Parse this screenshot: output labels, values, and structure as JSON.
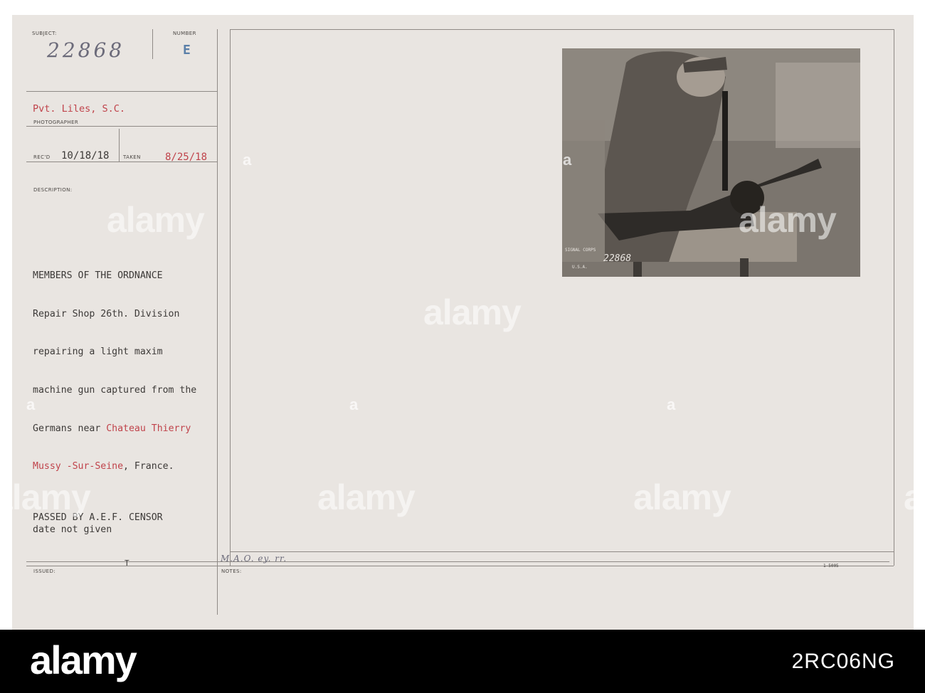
{
  "labels": {
    "subject": "SUBJECT:",
    "number": "NUMBER",
    "photographer": "PHOTOGRAPHER",
    "recd": "REC'D",
    "taken": "TAKEN",
    "description": "DESCRIPTION:",
    "issued": "ISSUED:",
    "notes": "NOTES:"
  },
  "record": {
    "subject_number": "22868",
    "number_stamp": "E",
    "photographer": "Pvt. Liles, S.C.",
    "recd_date": "10/18/18",
    "taken_date": "8/25/18",
    "description_lines": [
      "MEMBERS OF THE ORDNANCE",
      "Repair Shop 26th. Division",
      "repairing a light maxim",
      "machine gun captured from the",
      "Germans near",
      "Chateau Thierry",
      "Mussy -Sur-Seine",
      ", France."
    ],
    "censor_line1": "PASSED BY A.E.F. CENSOR",
    "censor_line2": "date not given",
    "issued_mark": "T",
    "notes_handwriting": "M.A.O. ey. rr.",
    "form_number": "1—5005"
  },
  "photo": {
    "stamp_number": "22868",
    "stamp_text": "SIGNAL CORPS",
    "stamp_sub": "U.S.A."
  },
  "watermark": {
    "brand": "alamy",
    "image_id": "2RC06NG"
  },
  "colors": {
    "card": "#e9e5e1",
    "red_ink": "#c0434b",
    "typewriter": "#3d3a38"
  }
}
